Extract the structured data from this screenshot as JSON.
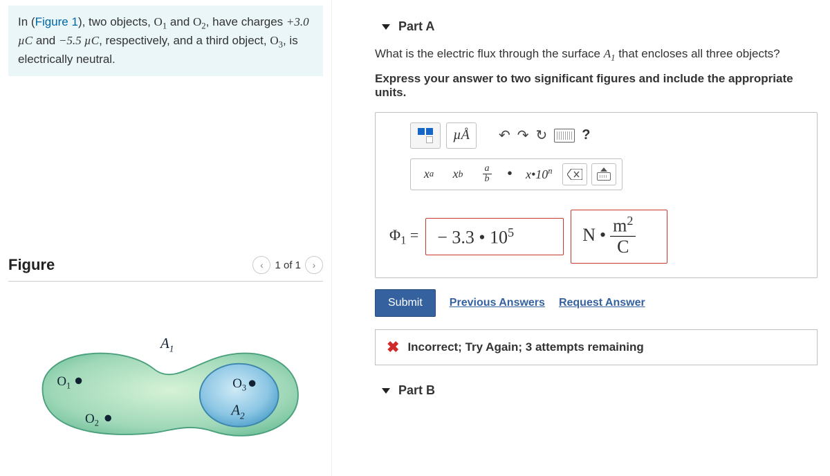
{
  "problem": {
    "prefix": "In (",
    "figlink": "Figure 1",
    "mid1": "), two objects, ",
    "o1": "O",
    "o2": "O",
    "seg1": " and ",
    "seg2": ", have charges ",
    "q1": "+3.0 µC",
    "and": " and ",
    "q2": "−5.5 µC",
    "seg3": ", respectively, and a third object, ",
    "o3": "O",
    "seg4": ", is electrically neutral."
  },
  "figure": {
    "title": "Figure",
    "pager": "1 of 1",
    "labels": {
      "A1": "A",
      "A2": "A",
      "O1": "O",
      "O2": "O",
      "O3": "O"
    }
  },
  "partA": {
    "header": "Part A",
    "question_pre": "What is the electric flux through the surface ",
    "A1": "A",
    "question_post": " that encloses all three objects?",
    "instruction": "Express your answer to two significant figures and include the appropriate units.",
    "phi_label": "Φ",
    "eq": " = ",
    "value": "− 3.3 • 10",
    "value_exp": "5",
    "unit_N": "N",
    "unit_dot": "•",
    "unit_top": "m",
    "unit_top_exp": "2",
    "unit_bot": "C"
  },
  "toolbar": {
    "mu_a": "µÅ",
    "xa": "x",
    "xa_sup": "a",
    "xb": "x",
    "xb_sub": "b",
    "frac_a": "a",
    "frac_b": "b",
    "sci": "x•10",
    "sci_exp": "n",
    "help": "?"
  },
  "actions": {
    "submit": "Submit",
    "prev": "Previous Answers",
    "req": "Request Answer"
  },
  "feedback": {
    "msg": "Incorrect; Try Again; 3 attempts remaining"
  },
  "partB": {
    "header": "Part B"
  }
}
